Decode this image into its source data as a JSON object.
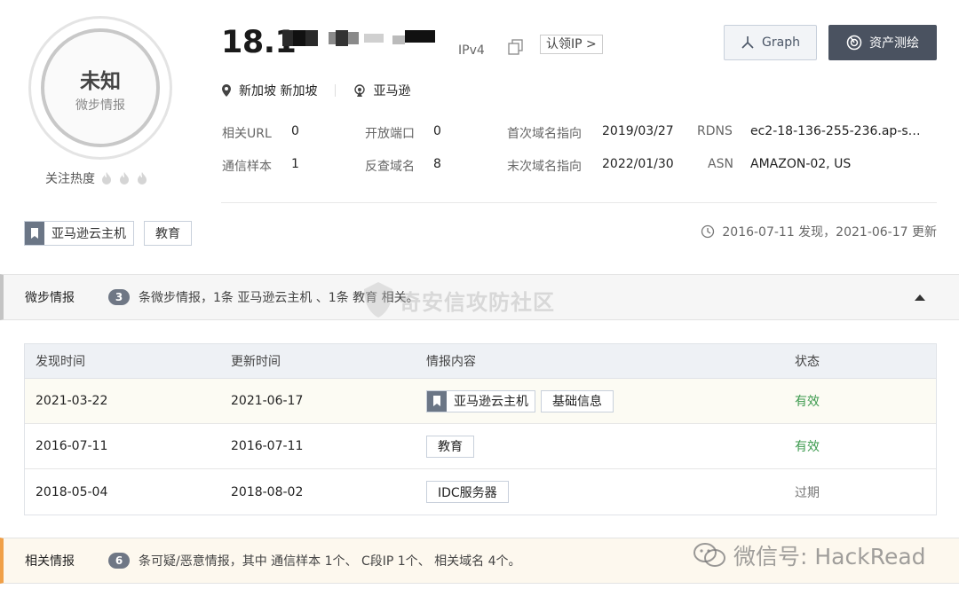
{
  "score": {
    "title": "未知",
    "subtitle": "微步情报"
  },
  "heat": {
    "label": "关注热度"
  },
  "header": {
    "ip_prefix": "18.1",
    "ip_version": "IPv4",
    "verify_label": "认领IP >",
    "graph_label": "Graph",
    "measure_label": "资产测绘",
    "location": "新加坡 新加坡",
    "isp": "亚马逊"
  },
  "info": {
    "related_url": {
      "label": "相关URL",
      "value": "0"
    },
    "open_ports": {
      "label": "开放端口",
      "value": "0"
    },
    "first_seen": {
      "label": "首次域名指向",
      "value": "2019/03/27"
    },
    "rdns": {
      "label": "RDNS",
      "value": "ec2-18-136-255-236.ap-s…"
    },
    "comm_samples": {
      "label": "通信样本",
      "value": "1"
    },
    "reverse_domains": {
      "label": "反查域名",
      "value": "8"
    },
    "last_seen": {
      "label": "末次域名指向",
      "value": "2022/01/30"
    },
    "asn": {
      "label": "ASN",
      "value": "AMAZON-02, US"
    }
  },
  "tags": {
    "cloud": "亚马逊云主机",
    "edu": "教育"
  },
  "dates": {
    "text": "2016-07-11 发现，2021-06-17 更新"
  },
  "intel_section": {
    "title": "微步情报",
    "count": "3",
    "desc": "条微步情报，1条 亚马逊云主机 、1条 教育 相关。"
  },
  "watermark": {
    "text": "奇安信攻防社区",
    "wechat": "微信号: HackRead"
  },
  "table": {
    "headers": [
      "发现时间",
      "更新时间",
      "情报内容",
      "状态"
    ],
    "rows": [
      {
        "found": "2021-03-22",
        "updated": "2021-06-17",
        "tag1": "亚马逊云主机",
        "tag2": "基础信息",
        "status": "有效"
      },
      {
        "found": "2016-07-11",
        "updated": "2016-07-11",
        "tag1": "教育",
        "status": "有效"
      },
      {
        "found": "2018-05-04",
        "updated": "2018-08-02",
        "tag1": "IDC服务器",
        "status": "过期"
      }
    ]
  },
  "related_section": {
    "title": "相关情报",
    "count": "6",
    "desc": "条可疑/恶意情报，其中 通信样本 1个、 C段IP 1个、 相关域名 4个。"
  },
  "colors": {
    "valid": "#3c9a4e",
    "accent": "#f0a048",
    "dark_button": "#4a5260"
  }
}
